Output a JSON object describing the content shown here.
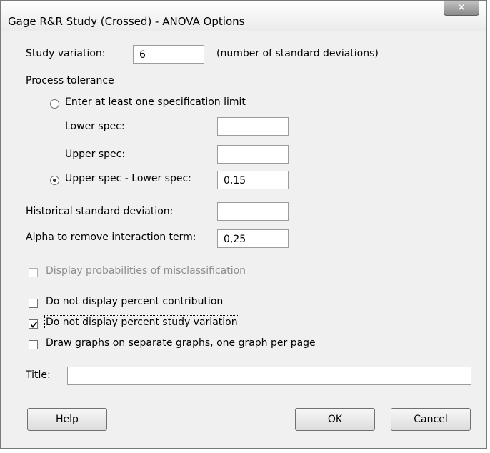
{
  "window": {
    "title": "Gage R&R Study (Crossed) - ANOVA Options"
  },
  "study_variation": {
    "label": "Study variation:",
    "value": "6",
    "note": "(number of standard deviations)"
  },
  "process_tolerance": {
    "heading": "Process tolerance",
    "option_spec_limit": {
      "label": "Enter at least one specification limit",
      "selected": false
    },
    "lower_spec": {
      "label": "Lower spec:",
      "value": ""
    },
    "upper_spec": {
      "label": "Upper spec:",
      "value": ""
    },
    "option_range": {
      "label": "Upper spec - Lower spec:",
      "selected": true,
      "value": "0,15"
    }
  },
  "historical_sd": {
    "label": "Historical standard deviation:",
    "value": ""
  },
  "alpha": {
    "label": "Alpha to remove interaction term:",
    "value": "0,25"
  },
  "checkboxes": {
    "misclassification": {
      "label": "Display probabilities of misclassification",
      "checked": false,
      "enabled": false
    },
    "percent_contribution": {
      "label": "Do not display percent contribution",
      "checked": false
    },
    "percent_study": {
      "label": "Do not display percent study variation",
      "checked": true
    },
    "separate_graphs": {
      "label": "Draw graphs on separate graphs, one graph per page",
      "checked": false
    }
  },
  "title_field": {
    "label": "Title:",
    "value": ""
  },
  "buttons": {
    "help": "Help",
    "ok": "OK",
    "cancel": "Cancel"
  },
  "icons": {
    "close": "close-icon",
    "checkmark": "checkmark-icon"
  }
}
